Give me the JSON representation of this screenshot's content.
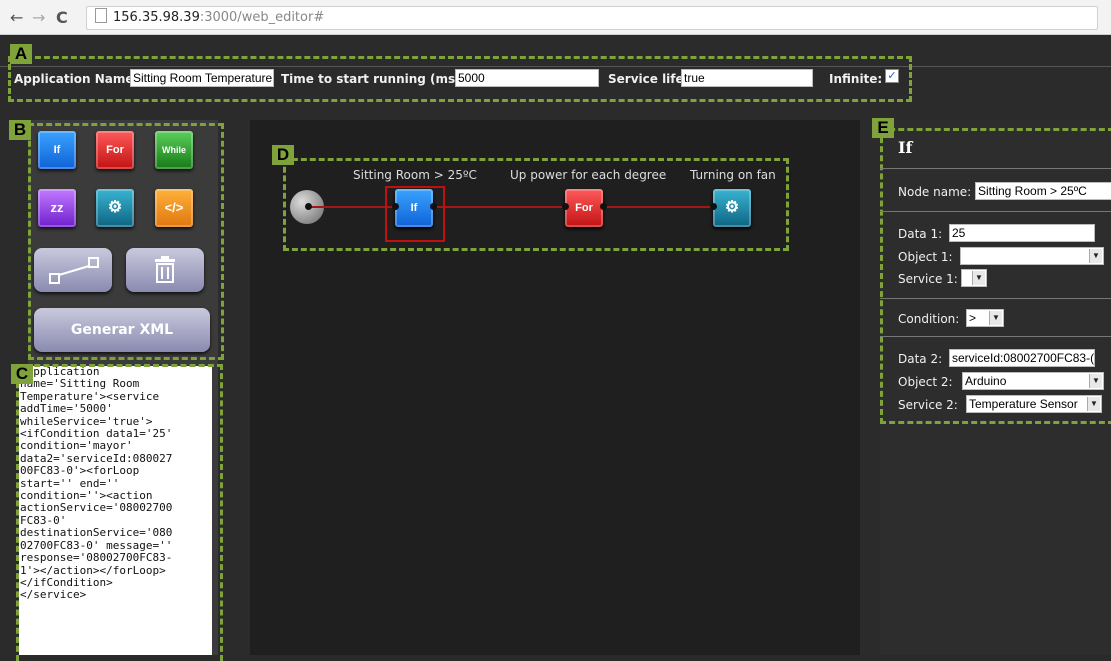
{
  "browser": {
    "address_host": "156.35.98.39",
    "address_path": ":3000/web_editor#"
  },
  "annotations": {
    "a": "A",
    "b": "B",
    "c": "C",
    "d": "D",
    "e": "E"
  },
  "app_settings": {
    "application_name_label": "Application Name:",
    "application_name_value": "Sitting Room Temperature",
    "start_time_label": "Time to start running (ms):",
    "start_time_value": "5000",
    "service_life_label": "Service life:",
    "service_life_value": "true",
    "infinite_label": "Infinite:",
    "infinite_checked": true
  },
  "toolbox": {
    "if_label": "If",
    "for_label": "For",
    "while_label": "While",
    "sleep_label": "zz",
    "service_label": "⚙",
    "code_label": "</>",
    "generate_xml_label": "Generar XML"
  },
  "xml_output": "<application\nname='Sitting Room\nTemperature'><service\naddTime='5000'\nwhileService='true'>\n<ifCondition data1='25'\ncondition='mayor'\ndata2='serviceId:080027\n00FC83-0'><forLoop\nstart='' end=''\ncondition=''><action\nactionService='08002700\nFC83-0'\ndestinationService='080\n02700FC83-0' message=''\nresponse='08002700FC83-\n1'></action></forLoop>\n</ifCondition>\n</service>",
  "flow": {
    "nodes": [
      {
        "label": "Sitting Room > 25ºC",
        "type": "If"
      },
      {
        "label": "Up power for each degree",
        "type": "For"
      },
      {
        "label": "Turning on fan",
        "type": "service"
      }
    ]
  },
  "properties": {
    "title": "If",
    "node_name_label": "Node name:",
    "node_name_value": "Sitting Room > 25ºC",
    "data1_label": "Data 1:",
    "data1_value": "25",
    "object1_label": "Object 1:",
    "object1_value": "",
    "service1_label": "Service 1:",
    "service1_value": "",
    "condition_label": "Condition:",
    "condition_value": ">",
    "data2_label": "Data 2:",
    "data2_value": "serviceId:08002700FC83-(",
    "object2_label": "Object 2:",
    "object2_value": "Arduino",
    "service2_label": "Service 2:",
    "service2_value": "Temperature Sensor"
  }
}
